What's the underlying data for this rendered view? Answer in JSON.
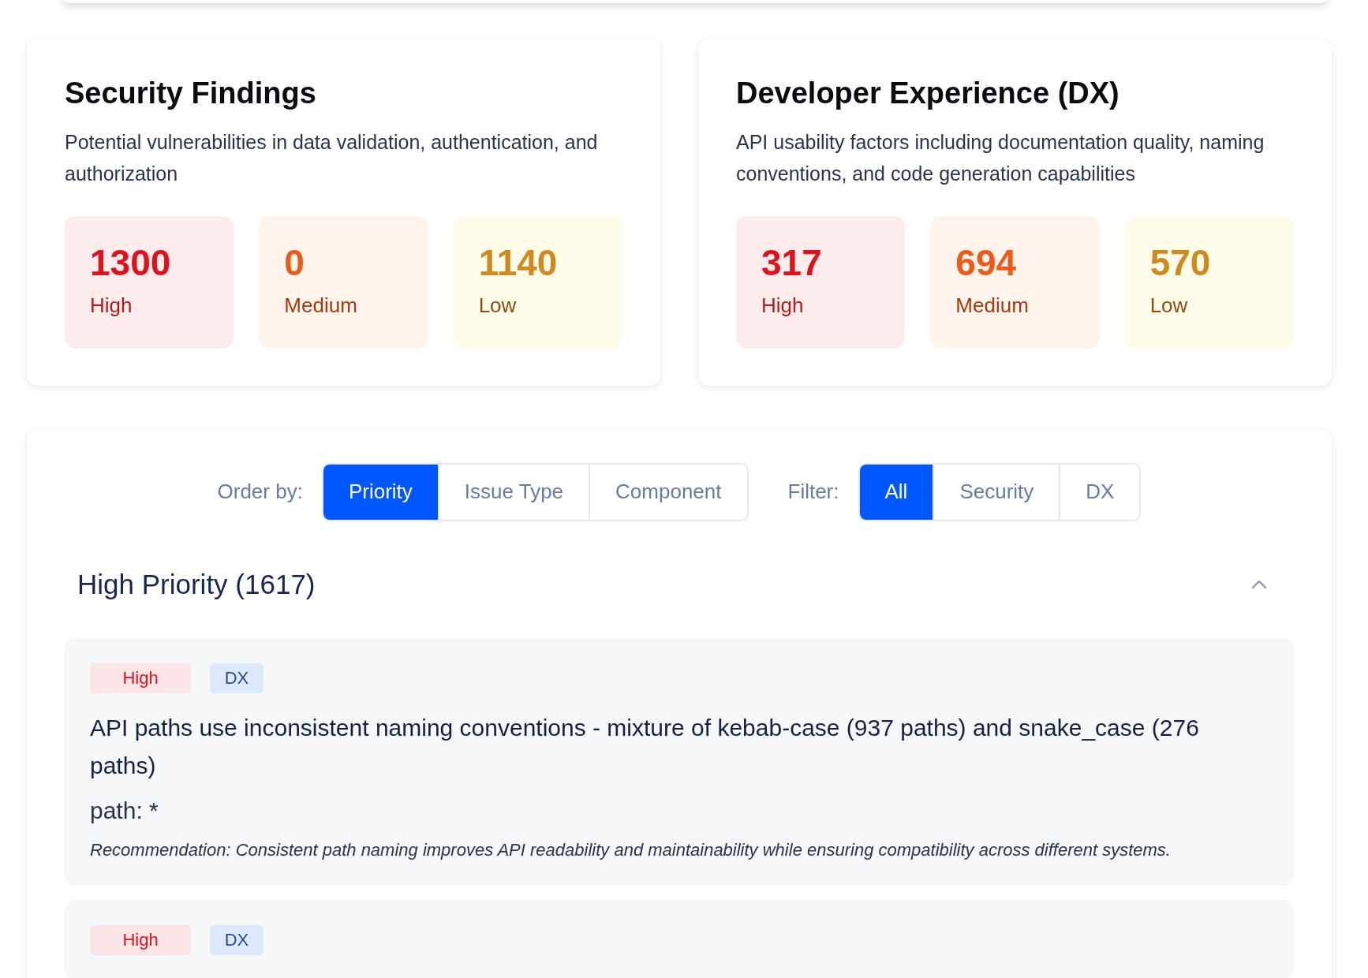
{
  "summary_cards": [
    {
      "title": "Security Findings",
      "description": "Potential vulnerabilities in data validation, authentication, and authorization",
      "stats": [
        {
          "kind": "high",
          "value": "1300",
          "label": "High"
        },
        {
          "kind": "medium",
          "value": "0",
          "label": "Medium"
        },
        {
          "kind": "low",
          "value": "1140",
          "label": "Low"
        }
      ]
    },
    {
      "title": "Developer Experience (DX)",
      "description": "API usability factors including documentation quality, naming conventions, and code generation capabilities",
      "stats": [
        {
          "kind": "high",
          "value": "317",
          "label": "High"
        },
        {
          "kind": "medium",
          "value": "694",
          "label": "Medium"
        },
        {
          "kind": "low",
          "value": "570",
          "label": "Low"
        }
      ]
    }
  ],
  "order_by": {
    "label": "Order by:",
    "options": [
      {
        "label": "Priority",
        "selected": true
      },
      {
        "label": "Issue Type",
        "selected": false
      },
      {
        "label": "Component",
        "selected": false
      }
    ]
  },
  "filter": {
    "label": "Filter:",
    "options": [
      {
        "label": "All",
        "selected": true
      },
      {
        "label": "Security",
        "selected": false
      },
      {
        "label": "DX",
        "selected": false
      }
    ]
  },
  "group": {
    "title": "High Priority (1617)",
    "expanded": true
  },
  "issues": [
    {
      "tags": [
        {
          "kind": "high",
          "label": "High"
        },
        {
          "kind": "dx",
          "label": "DX"
        }
      ],
      "title": "API paths use inconsistent naming conventions - mixture of kebab-case (937 paths) and snake_case (276 paths)",
      "path": "path: *",
      "recommendation": "Recommendation: Consistent path naming improves API readability and maintainability while ensuring compatibility across different systems."
    },
    {
      "tags": [
        {
          "kind": "high",
          "label": "High"
        },
        {
          "kind": "dx",
          "label": "DX"
        }
      ]
    }
  ]
}
